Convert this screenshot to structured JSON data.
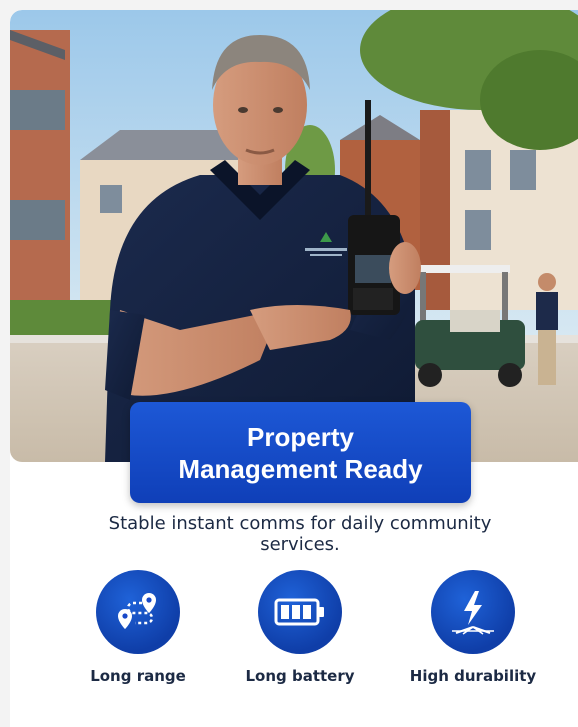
{
  "hero": {
    "title_line1": "Property",
    "title_line2": "Management Ready",
    "subtitle": "Stable instant comms for daily community services."
  },
  "features": [
    {
      "label": "Long range",
      "icon": "route-location-icon"
    },
    {
      "label": "Long battery",
      "icon": "battery-icon"
    },
    {
      "label": "High durability",
      "icon": "impact-bolt-icon"
    }
  ],
  "colors": {
    "accent": "#1848c8",
    "text": "#1c2a44"
  }
}
